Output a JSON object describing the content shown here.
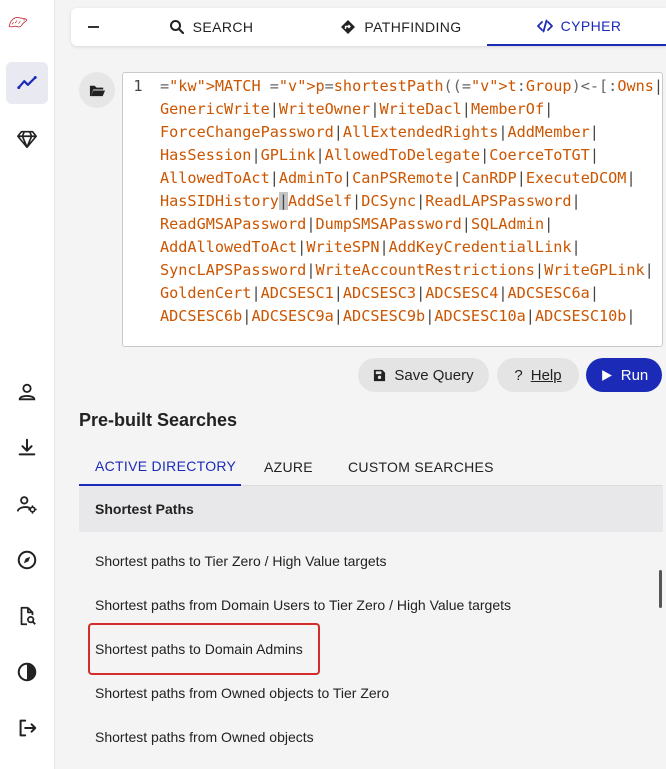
{
  "sidebar": {
    "icons": [
      "bloodhound-logo",
      "explore-icon",
      "gem-icon",
      "user-icon",
      "download-icon",
      "user-gear-icon",
      "compass-icon",
      "file-search-icon",
      "contrast-icon",
      "logout-icon"
    ]
  },
  "tabs": {
    "search": "SEARCH",
    "pathfinding": "PATHFINDING",
    "cypher": "CYPHER",
    "active": "cypher"
  },
  "editor": {
    "line_number": "1",
    "query": "MATCH p=shortestPath((t:Group)<-[:Owns|GenericAll|GenericWrite|WriteOwner|WriteDacl|MemberOf|ForceChangePassword|AllExtendedRights|AddMember|HasSession|GPLink|AllowedToDelegate|CoerceToTGT|AllowedToAct|AdminTo|CanPSRemote|CanRDP|ExecuteDCOM|HasSIDHistory|AddSelf|DCSync|ReadLAPSPassword|ReadGMSAPassword|DumpSMSAPassword|SQLAdmin|AddAllowedToAct|WriteSPN|AddKeyCredentialLink|SyncLAPSPassword|WriteAccountRestrictions|WriteGPLink|GoldenCert|ADCSESC1|ADCSESC3|ADCSESC4|ADCSESC6a|ADCSESC6b|ADCSESC9a|ADCSESC9b|ADCSESC10a|ADCSESC10b|"
  },
  "actions": {
    "save_query": "Save Query",
    "help_mark": "?",
    "help": "Help",
    "run": "Run"
  },
  "prebuilt": {
    "title": "Pre-built Searches",
    "tabs": [
      "ACTIVE DIRECTORY",
      "AZURE",
      "CUSTOM SEARCHES"
    ],
    "active_tab": "ACTIVE DIRECTORY",
    "category": "Shortest Paths",
    "items": [
      "Shortest paths to Tier Zero / High Value targets",
      "Shortest paths from Domain Users to Tier Zero / High Value targets",
      "Shortest paths to Domain Admins",
      "Shortest paths from Owned objects to Tier Zero",
      "Shortest paths from Owned objects"
    ],
    "highlighted_item": "Shortest paths to Domain Admins"
  },
  "colors": {
    "accent": "#1b2bb8",
    "highlight": "#d42b2b",
    "keyword": "#8a5a00",
    "identifier": "#cc5500"
  }
}
